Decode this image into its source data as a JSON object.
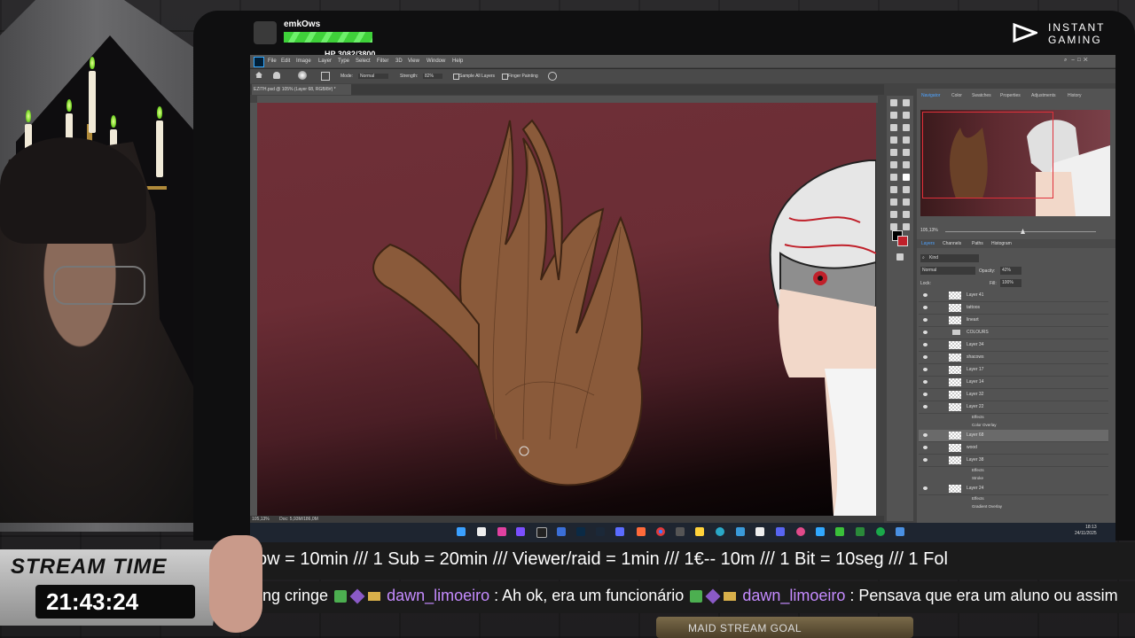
{
  "stream": {
    "username": "emkOws",
    "hp": "HP 3082/3800",
    "brand_line1": "INSTANT",
    "brand_line2": "GAMING",
    "ticker": "ow = 10min /// 1 Sub = 20min /// Viewer/raid = 1min ///  1€-- 10m /// 1 Bit = 10seg  /// 1 Fol",
    "chat_prefix": "ng cringe",
    "chat_user1": "dawn_limoeiro",
    "chat_msg1": ": Ah ok, era um funcionário",
    "chat_user2": "dawn_limoeiro",
    "chat_msg2": ": Pensava que era um aluno ou assim",
    "goal": "MAID STREAM GOAL",
    "time_label": "STREAM TIME",
    "time_value": "21:43:24"
  },
  "photoshop": {
    "menus": [
      "File",
      "Edit",
      "Image",
      "Layer",
      "Type",
      "Select",
      "Filter",
      "3D",
      "View",
      "Window",
      "Help"
    ],
    "options": {
      "mode_label": "Mode:",
      "mode_value": "Normal",
      "strength_label": "Strength:",
      "strength_value": "82%",
      "sample_all": "Sample All Layers",
      "finger_painting": "Finger Painting"
    },
    "doc_tab": "EZITH.psd @ 105% (Layer 68, RGB/8#) *",
    "status_zoom": "105,13%",
    "status_doc": "Doc: 5,93M/186,0M",
    "panel_tabs": [
      "Navigator",
      "Color",
      "Swatches",
      "Properties",
      "Adjustments",
      "History"
    ],
    "nav_zoom": "105,13%",
    "layer_tabs": [
      "Layers",
      "Channels",
      "Paths",
      "Histogram"
    ],
    "kind": "Kind",
    "blend": "Normal",
    "opacity_label": "Opacity:",
    "opacity_value": "42%",
    "lock_label": "Lock:",
    "fill_label": "Fill:",
    "fill_value": "100%",
    "layers": [
      {
        "name": "Layer 41",
        "kind": "layer"
      },
      {
        "name": "tattoos",
        "kind": "layer"
      },
      {
        "name": "lineart",
        "kind": "layer"
      },
      {
        "name": "COLOURS",
        "kind": "group"
      },
      {
        "name": "Layer 34",
        "kind": "layer"
      },
      {
        "name": "shacows",
        "kind": "layer"
      },
      {
        "name": "Layer 17",
        "kind": "layer"
      },
      {
        "name": "Layer 14",
        "kind": "layer"
      },
      {
        "name": "Layer 32",
        "kind": "layer"
      },
      {
        "name": "Layer 22",
        "kind": "layer"
      },
      {
        "name": "Effects",
        "kind": "sub"
      },
      {
        "name": "Color Overlay",
        "kind": "sub"
      },
      {
        "name": "Layer 68",
        "kind": "selected"
      },
      {
        "name": "wood",
        "kind": "layer"
      },
      {
        "name": "Layer 38",
        "kind": "layer"
      },
      {
        "name": "Effects",
        "kind": "sub"
      },
      {
        "name": "Stroke",
        "kind": "sub"
      },
      {
        "name": "Layer 24",
        "kind": "layer"
      },
      {
        "name": "Effects",
        "kind": "sub"
      },
      {
        "name": "Gradient Overlay",
        "kind": "sub"
      }
    ]
  },
  "taskbar": {
    "time": "18:13",
    "date": "24/11/2025"
  }
}
